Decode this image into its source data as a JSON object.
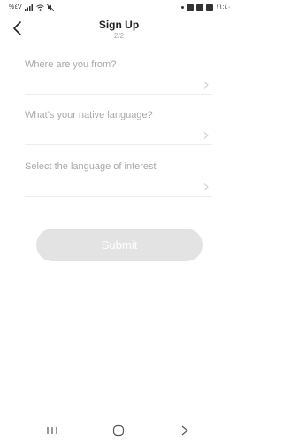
{
  "status_bar": {
    "left_text": "%٤V",
    "right_time": "١١:٤٠"
  },
  "header": {
    "title": "Sign Up",
    "step": "2/2"
  },
  "form": {
    "fields": [
      {
        "label": "Where are you from?"
      },
      {
        "label": "What’s your native language?"
      },
      {
        "label": "Select the language of interest"
      }
    ],
    "submit_label": "Submit"
  },
  "colors": {
    "submit_bg": "#e3e3e3",
    "placeholder_text": "#a8a8a8",
    "divider": "#eeeeee"
  },
  "icons": {
    "back": "chevron-left-icon",
    "field_arrow": "chevron-right-icon",
    "nav_recents": "recents-icon",
    "nav_home": "home-icon",
    "nav_back": "back-icon"
  }
}
